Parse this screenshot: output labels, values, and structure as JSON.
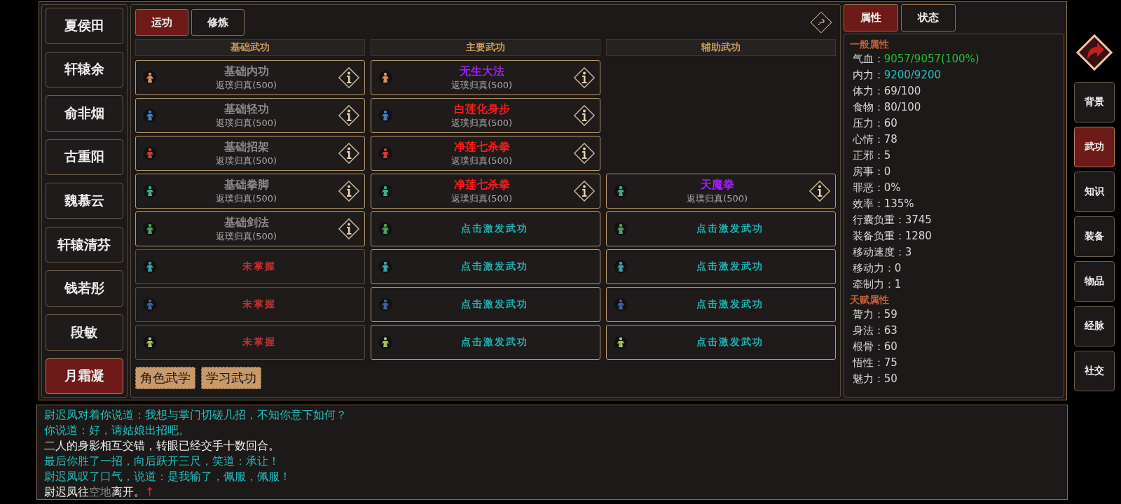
{
  "characters": [
    {
      "name": "夏侯田",
      "selected": false
    },
    {
      "name": "轩辕余",
      "selected": false
    },
    {
      "name": "俞非烟",
      "selected": false
    },
    {
      "name": "古重阳",
      "selected": false
    },
    {
      "name": "魏慕云",
      "selected": false
    },
    {
      "name": "轩辕清芬",
      "selected": false
    },
    {
      "name": "钱若彤",
      "selected": false
    },
    {
      "name": "段敏",
      "selected": false
    },
    {
      "name": "月霜凝",
      "selected": true
    }
  ],
  "skill_tabs": [
    {
      "label": "运功",
      "selected": true
    },
    {
      "label": "修炼",
      "selected": false
    }
  ],
  "help": "?",
  "columns": [
    {
      "header": "基础武功",
      "slots": [
        {
          "kind": "learned",
          "name": "基础内功",
          "color": "#8c8c8c",
          "level": "返璞归真(500)"
        },
        {
          "kind": "learned",
          "name": "基础轻功",
          "color": "#8c8c8c",
          "level": "返璞归真(500)"
        },
        {
          "kind": "learned",
          "name": "基础招架",
          "color": "#8c8c8c",
          "level": "返璞归真(500)"
        },
        {
          "kind": "learned",
          "name": "基础拳脚",
          "color": "#8c8c8c",
          "level": "返璞归真(500)"
        },
        {
          "kind": "learned",
          "name": "基础剑法",
          "color": "#8c8c8c",
          "level": "返璞归真(500)"
        },
        {
          "kind": "unlearned",
          "text": "未掌握"
        },
        {
          "kind": "unlearned",
          "text": "未掌握"
        },
        {
          "kind": "unlearned",
          "text": "未掌握"
        }
      ]
    },
    {
      "header": "主要武功",
      "slots": [
        {
          "kind": "learned",
          "name": "无生大法",
          "color": "#a020f0",
          "level": "返璞归真(500)"
        },
        {
          "kind": "learned",
          "name": "白莲化身步",
          "color": "#ff1a1a",
          "level": "返璞归真(500)"
        },
        {
          "kind": "learned",
          "name": "净莲七杀拳",
          "color": "#ff1a1a",
          "level": "返璞归真(500)"
        },
        {
          "kind": "learned",
          "name": "净莲七杀拳",
          "color": "#ff1a1a",
          "level": "返璞归真(500)"
        },
        {
          "kind": "activate",
          "text": "点击激发武功"
        },
        {
          "kind": "activate",
          "text": "点击激发武功"
        },
        {
          "kind": "activate",
          "text": "点击激发武功"
        },
        {
          "kind": "activate",
          "text": "点击激发武功"
        }
      ]
    },
    {
      "header": "辅助武功",
      "slots": [
        {
          "kind": "empty"
        },
        {
          "kind": "empty"
        },
        {
          "kind": "empty"
        },
        {
          "kind": "learned",
          "name": "天魔拳",
          "color": "#a020f0",
          "level": "返璞归真(500)"
        },
        {
          "kind": "activate",
          "text": "点击激发武功"
        },
        {
          "kind": "activate",
          "text": "点击激发武功"
        },
        {
          "kind": "activate",
          "text": "点击激发武功"
        },
        {
          "kind": "activate",
          "text": "点击激发武功"
        }
      ]
    }
  ],
  "bottom_buttons": [
    "角色武学",
    "学习武功"
  ],
  "info_tabs": [
    {
      "label": "属性",
      "selected": true
    },
    {
      "label": "状态",
      "selected": false
    }
  ],
  "stat_sections": [
    {
      "title": "一般属性",
      "stats": [
        {
          "label": "气血：",
          "value": "9057/9057(100%)",
          "color": "#1fc23a"
        },
        {
          "label": "内力：",
          "value": "9200/9200",
          "color": "#1ec3c3"
        },
        {
          "label": "体力：",
          "value": "69/100",
          "color": "#d8d8d8"
        },
        {
          "label": "食物：",
          "value": "80/100",
          "color": "#d8d8d8"
        },
        {
          "label": "压力：",
          "value": "60",
          "color": "#d8d8d8"
        },
        {
          "label": "心情：",
          "value": "78",
          "color": "#d8d8d8"
        },
        {
          "label": "正邪：",
          "value": "5",
          "color": "#d8d8d8"
        },
        {
          "label": "房事：",
          "value": "0",
          "color": "#d8d8d8"
        },
        {
          "label": "罪恶：",
          "value": "0%",
          "color": "#d8d8d8"
        },
        {
          "label": "效率：",
          "value": "135%",
          "color": "#d8d8d8"
        },
        {
          "label": "行囊负重：",
          "value": "3745",
          "color": "#d8d8d8"
        },
        {
          "label": "装备负重：",
          "value": "1280",
          "color": "#d8d8d8"
        },
        {
          "label": "移动速度：",
          "value": "3",
          "color": "#d8d8d8"
        },
        {
          "label": "移动力：",
          "value": "0",
          "color": "#d8d8d8"
        },
        {
          "label": "牵制力：",
          "value": "1",
          "color": "#d8d8d8"
        }
      ]
    },
    {
      "title": "天赋属性",
      "stats": [
        {
          "label": "膂力：",
          "value": "59",
          "color": "#d8d8d8"
        },
        {
          "label": "身法：",
          "value": "63",
          "color": "#d8d8d8"
        },
        {
          "label": "根骨：",
          "value": "60",
          "color": "#d8d8d8"
        },
        {
          "label": "悟性：",
          "value": "75",
          "color": "#d8d8d8"
        },
        {
          "label": "魅力：",
          "value": "50",
          "color": "#d8d8d8"
        }
      ]
    }
  ],
  "side_menu": [
    {
      "label": "背景",
      "selected": false
    },
    {
      "label": "武功",
      "selected": true
    },
    {
      "label": "知识",
      "selected": false
    },
    {
      "label": "装备",
      "selected": false
    },
    {
      "label": "物品",
      "selected": false
    },
    {
      "label": "经脉",
      "selected": false
    },
    {
      "label": "社交",
      "selected": false
    }
  ],
  "log": [
    {
      "parts": [
        {
          "text": "尉迟凤对着你说道：我想与掌门切磋几招，不知你意下如何？",
          "color": "#20c0c0"
        }
      ]
    },
    {
      "parts": [
        {
          "text": "你说道：好，请姑娘出招吧。",
          "color": "#20c0c0"
        }
      ]
    },
    {
      "parts": [
        {
          "text": "二人的身影相互交错，转眼已经交手十数回合。",
          "color": "#f0f0f0"
        }
      ]
    },
    {
      "parts": [
        {
          "text": "最后你胜了一招，向后跃开三尺，笑道：承让！",
          "color": "#20c0c0"
        }
      ]
    },
    {
      "parts": [
        {
          "text": "尉迟凤叹了口气，说道：是我输了，佩服，佩服！",
          "color": "#20c0c0"
        }
      ]
    },
    {
      "parts": [
        {
          "text": "尉迟凤往",
          "color": "#f0f0f0"
        },
        {
          "text": "空地",
          "color": "#8a8a8a"
        },
        {
          "text": "离开。",
          "color": "#f0f0f0"
        },
        {
          "text": "↑",
          "color": "#ff2020"
        }
      ]
    }
  ]
}
